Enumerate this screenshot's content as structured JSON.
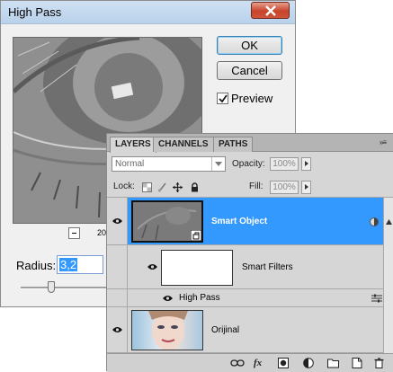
{
  "dialog": {
    "title": "High Pass",
    "ok_label": "OK",
    "cancel_label": "Cancel",
    "preview_label": "Preview",
    "preview_checked": true,
    "zoom_text": "20",
    "radius_label": "Radius:",
    "radius_value": "3,2"
  },
  "panel": {
    "tabs": [
      "LAYERS",
      "CHANNELS",
      "PATHS"
    ],
    "menu_icon": "»≡",
    "blend_mode": "Normal",
    "opacity_label": "Opacity:",
    "opacity_value": "100%",
    "lock_label": "Lock:",
    "fill_label": "Fill:",
    "fill_value": "100%",
    "layers": {
      "smart_object": "Smart Object",
      "smart_filters": "Smart Filters",
      "high_pass": "High Pass",
      "original": "Orijinal"
    },
    "bottom_icons": [
      "link-icon",
      "fx-icon",
      "mask-icon",
      "adjustment-icon",
      "folder-icon",
      "new-layer-icon",
      "trash-icon"
    ],
    "fx_text": "fx"
  },
  "colors": {
    "selection": "#3399ff",
    "dialog_bg": "#f0f0f0",
    "panel_bg": "#d6d6d6",
    "close_button": "#c7432a"
  }
}
